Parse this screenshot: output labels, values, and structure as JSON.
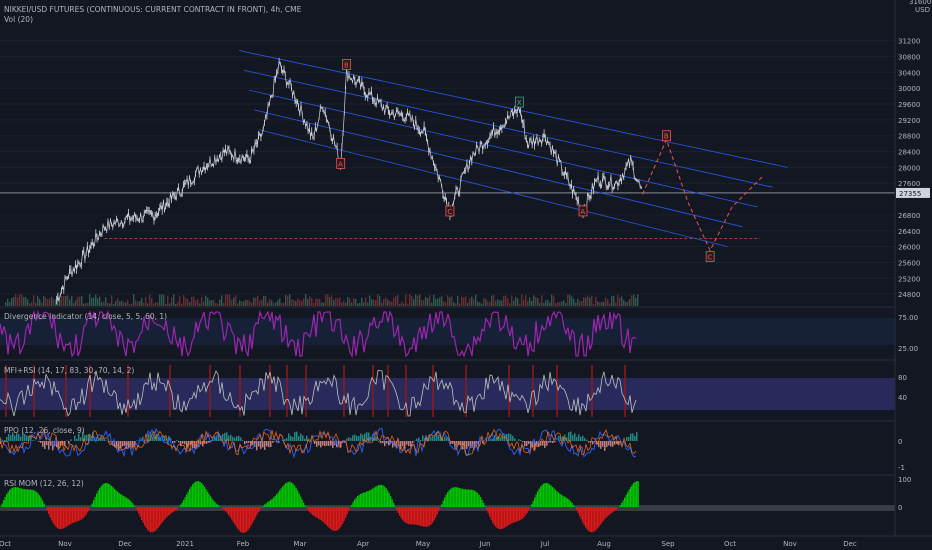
{
  "header": {
    "title": "NIKKEI/USD FUTURES (CONTINUOUS: CURRENT CONTRACT IN FRONT), 4h, CME",
    "vol_label": "Vol (20)",
    "currency": "USD"
  },
  "price_panel": {
    "current_price": "27355",
    "y_ticks": [
      "31200",
      "30800",
      "30400",
      "30000",
      "29600",
      "29200",
      "28800",
      "28400",
      "28000",
      "27600",
      "26800",
      "26400",
      "26000",
      "25600",
      "25200",
      "24800"
    ],
    "top_tick": "31600",
    "wave_labels": [
      {
        "label": "B",
        "date": "2021-03-22",
        "price": 30600,
        "color": "red"
      },
      {
        "label": "A",
        "date": "2021-03-19",
        "price": 28100,
        "color": "red"
      },
      {
        "label": "X",
        "date": "2021-06-17",
        "price": 29650,
        "color": "green"
      },
      {
        "label": "C",
        "date": "2021-05-13",
        "price": 26900,
        "color": "red"
      },
      {
        "label": "A",
        "date": "2021-07-19",
        "price": 26900,
        "color": "red"
      },
      {
        "label": "B",
        "date": "2021-08-30",
        "price": 28800,
        "color": "red"
      },
      {
        "label": "C",
        "date": "2021-09-21",
        "price": 25750,
        "color": "red"
      }
    ]
  },
  "indicators": {
    "divergence": {
      "label": "Divergence Indicator (14, close, 5, 5, 60, 1)",
      "ticks": [
        "75.00",
        "25.00"
      ]
    },
    "mfi_rsi": {
      "label": "MFI+RSI (14, 17, 83, 30, 70, 14, 2)",
      "ticks": [
        "80",
        "40"
      ]
    },
    "ppo": {
      "label": "PPO (12, 26, close, 9)",
      "ticks": [
        "0",
        "-1"
      ]
    },
    "rsi_mom": {
      "label": "RSI MOM (12, 26, 12)",
      "ticks": [
        "100",
        "0"
      ]
    }
  },
  "x_axis": {
    "labels": [
      "Oct",
      "Nov",
      "Dec",
      "2021",
      "Feb",
      "Mar",
      "Apr",
      "May",
      "Jun",
      "Jul",
      "Aug",
      "Sep",
      "Oct",
      "Nov",
      "Dec"
    ]
  },
  "colors": {
    "background": "#131722",
    "channel": "#2962ff",
    "candle": "#d1d4dc",
    "projection": "#ef5350",
    "divergence_line": "#9c27b0",
    "rsi_mom_up": "#26a69a",
    "rsi_mom_up_bright": "#00c800",
    "rsi_mom_down": "#e01818"
  },
  "chart_data": {
    "type": "line",
    "title": "NIKKEI/USD FUTURES (CONTINUOUS: CURRENT CONTRACT IN FRONT), 4h, CME",
    "x_unit": "date",
    "x": [
      "2020-10-27",
      "2020-11-02",
      "2020-11-09",
      "2020-11-20",
      "2020-12-01",
      "2020-12-15",
      "2020-12-28",
      "2021-01-08",
      "2021-01-20",
      "2021-02-01",
      "2021-02-08",
      "2021-02-16",
      "2021-02-24",
      "2021-03-05",
      "2021-03-10",
      "2021-03-19",
      "2021-03-22",
      "2021-04-01",
      "2021-04-12",
      "2021-04-21",
      "2021-04-30",
      "2021-05-13",
      "2021-05-24",
      "2021-06-04",
      "2021-06-17",
      "2021-06-21",
      "2021-06-30",
      "2021-07-09",
      "2021-07-19",
      "2021-07-26",
      "2021-08-05",
      "2021-08-12",
      "2021-08-18"
    ],
    "series": [
      {
        "values": [
          24650,
          25300,
          25700,
          26500,
          26700,
          26800,
          27400,
          28000,
          28400,
          28200,
          28900,
          30600,
          29800,
          28700,
          29600,
          28100,
          30400,
          29900,
          29400,
          29300,
          28900,
          26900,
          28300,
          28900,
          29500,
          28600,
          28800,
          27900,
          26900,
          27700,
          27600,
          28150,
          27320
        ]
      }
    ],
    "channel": {
      "start_date": "2021-02-16",
      "end_date": "2021-10-30",
      "upper_start": 30800,
      "upper_end": 28000,
      "lower_start": 28800,
      "lower_end": 26000
    },
    "projection": {
      "dates": [
        "2021-08-18",
        "2021-08-30",
        "2021-09-10",
        "2021-09-21",
        "2021-10-02",
        "2021-10-18"
      ],
      "values": [
        27320,
        28700,
        27100,
        25900,
        27000,
        27800
      ]
    },
    "support_level": 26200,
    "ylim": [
      24600,
      31700
    ]
  }
}
